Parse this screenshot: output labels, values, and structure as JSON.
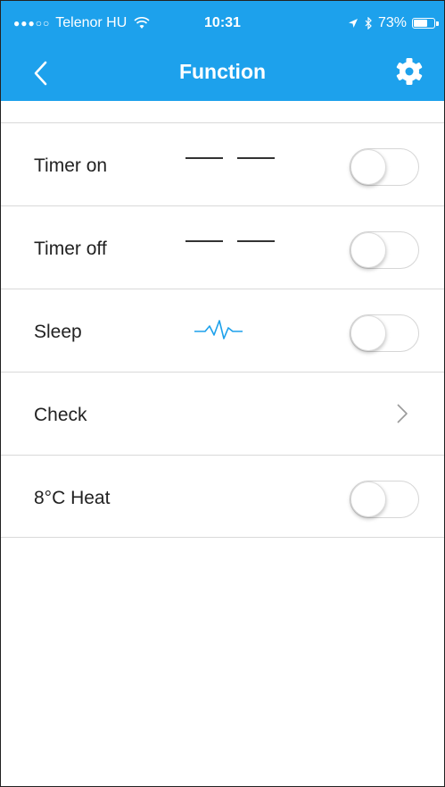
{
  "status_bar": {
    "signal_dots": "●●●○○",
    "carrier": "Telenor HU",
    "time": "10:31",
    "battery": "73%",
    "battery_level": 0.73
  },
  "header": {
    "title": "Function",
    "background_color": "#1da1ec",
    "back_icon": "chevron-left-icon",
    "settings_icon": "gear-icon"
  },
  "rows": [
    {
      "label": "Timer on",
      "value": "— —",
      "control": "toggle",
      "on": false
    },
    {
      "label": "Timer off",
      "value": "— —",
      "control": "toggle",
      "on": false
    },
    {
      "label": "Sleep",
      "icon": "sleep-wave-icon",
      "control": "toggle",
      "on": false
    },
    {
      "label": "Check",
      "control": "chevron-right-icon"
    },
    {
      "label": "8°C Heat",
      "control": "toggle",
      "on": false
    }
  ]
}
